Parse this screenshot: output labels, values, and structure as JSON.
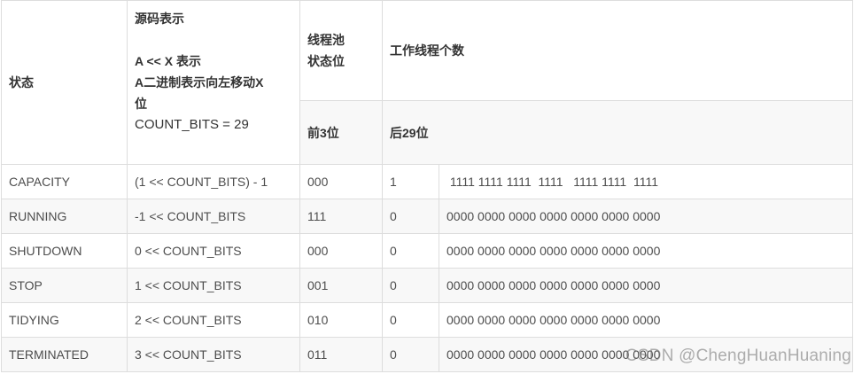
{
  "header": {
    "status": "状态",
    "source_title": "源码表示",
    "source_line1": "A << X 表示",
    "source_line2": "A二进制表示向左移动X",
    "source_line3": "位",
    "source_count_bits": "COUNT_BITS = 29",
    "pool_state": "线程池",
    "pool_state2": "状态位",
    "worker_count": "工作线程个数",
    "first3": "前3位",
    "last29": "后29位"
  },
  "rows": [
    {
      "name": "CAPACITY",
      "code": "(1 << COUNT_BITS) - 1",
      "state_bits": "000",
      "lead": "1",
      "rest": " 1111 1111 1111  1111   1111 1111  1111"
    },
    {
      "name": "RUNNING",
      "code": "-1 << COUNT_BITS",
      "state_bits": "111",
      "lead": "0",
      "rest": "0000 0000 0000 0000 0000 0000 0000"
    },
    {
      "name": "SHUTDOWN",
      "code": "0 << COUNT_BITS",
      "state_bits": "000",
      "lead": "0",
      "rest": "0000 0000 0000 0000 0000 0000 0000"
    },
    {
      "name": "STOP",
      "code": "1 << COUNT_BITS",
      "state_bits": "001",
      "lead": "0",
      "rest": "0000 0000 0000 0000 0000 0000 0000"
    },
    {
      "name": "TIDYING",
      "code": "2 << COUNT_BITS",
      "state_bits": "010",
      "lead": "0",
      "rest": "0000 0000 0000 0000 0000 0000 0000"
    },
    {
      "name": "TERMINATED",
      "code": "3 << COUNT_BITS",
      "state_bits": "011",
      "lead": "0",
      "rest": "0000 0000 0000 0000 0000 0000 0000"
    }
  ],
  "watermark": "CSDN @ChengHuanHuaning"
}
